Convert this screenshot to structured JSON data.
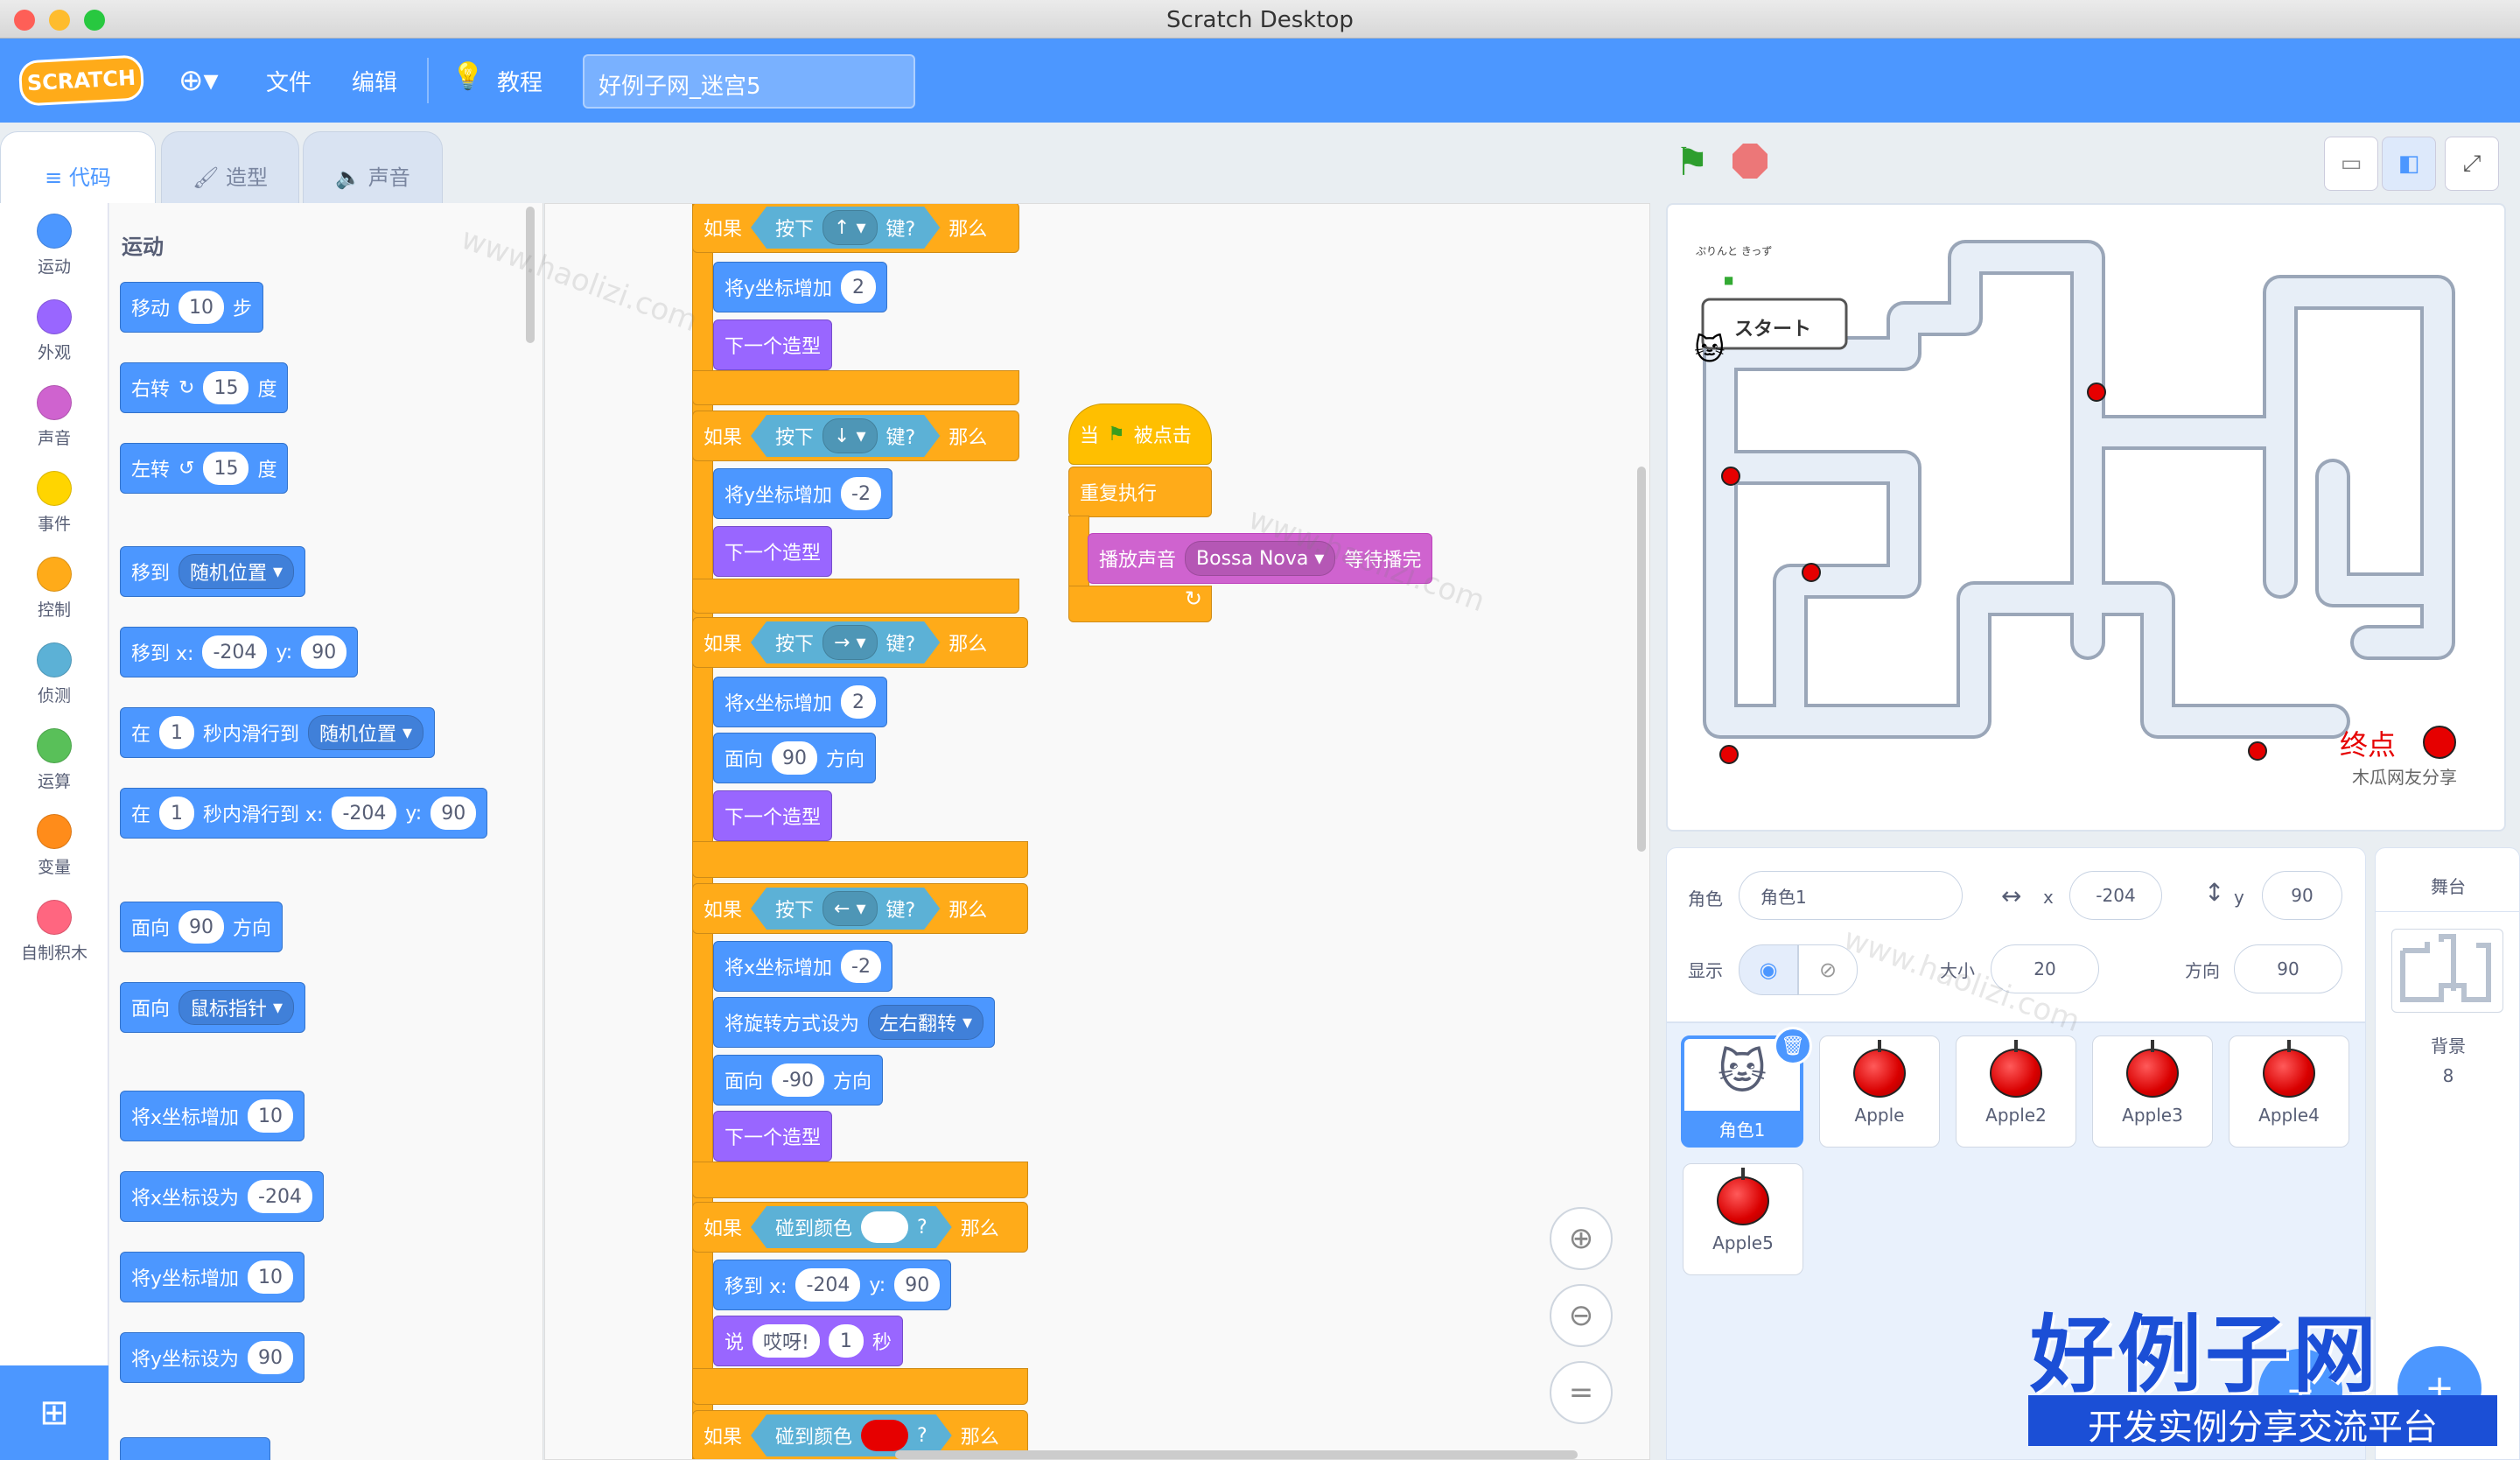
{
  "window": {
    "title": "Scratch Desktop"
  },
  "menu": {
    "logo": "SCRATCH",
    "file": "文件",
    "edit": "编辑",
    "tutorials": "教程",
    "project_title": "好例子网_迷宫5"
  },
  "tabs": {
    "code": "代码",
    "costumes": "造型",
    "sounds": "声音"
  },
  "categories": [
    {
      "label": "运动",
      "color": "#4c97ff"
    },
    {
      "label": "外观",
      "color": "#9966ff"
    },
    {
      "label": "声音",
      "color": "#cf63cf"
    },
    {
      "label": "事件",
      "color": "#ffd500"
    },
    {
      "label": "控制",
      "color": "#ffab19"
    },
    {
      "label": "侦测",
      "color": "#5cb1d6"
    },
    {
      "label": "运算",
      "color": "#59c059"
    },
    {
      "label": "变量",
      "color": "#ff8c1a"
    },
    {
      "label": "自制积木",
      "color": "#ff6680"
    }
  ],
  "palette": {
    "heading": "运动",
    "move": {
      "a": "移动",
      "v": "10",
      "b": "步"
    },
    "turn_right": {
      "a": "右转",
      "v": "15",
      "b": "度"
    },
    "turn_left": {
      "a": "左转",
      "v": "15",
      "b": "度"
    },
    "goto": {
      "a": "移到",
      "dd": "随机位置"
    },
    "goto_xy": {
      "a": "移到 x:",
      "x": "-204",
      "y_label": "y:",
      "y": "90"
    },
    "glide": {
      "a": "在",
      "v": "1",
      "b": "秒内滑行到",
      "dd": "随机位置"
    },
    "glide_xy": {
      "a": "在",
      "v": "1",
      "b": "秒内滑行到 x:",
      "x": "-204",
      "y_label": "y:",
      "y": "90"
    },
    "point": {
      "a": "面向",
      "v": "90",
      "b": "方向"
    },
    "point_towards": {
      "a": "面向",
      "dd": "鼠标指针"
    },
    "change_x": {
      "a": "将x坐标增加",
      "v": "10"
    },
    "set_x": {
      "a": "将x坐标设为",
      "v": "-204"
    },
    "change_y": {
      "a": "将y坐标增加",
      "v": "10"
    },
    "set_y": {
      "a": "将y坐标设为",
      "v": "90"
    }
  },
  "script": {
    "if": "如果",
    "key_pressed": "按下",
    "key_suffix": "键?",
    "then": "那么",
    "up": "↑",
    "down": "↓",
    "right": "→",
    "left": "←",
    "change_y": "将y坐标增加",
    "change_x": "将x坐标增加",
    "next_costume": "下一个造型",
    "v2": "2",
    "vm2": "-2",
    "point": "面向",
    "dir": "方向",
    "v90": "90",
    "vm90": "-90",
    "rotation": "将旋转方式设为",
    "rotation_dd": "左右翻转",
    "touching_color": "碰到颜色",
    "q": "?",
    "goto": "移到 x:",
    "x": "-204",
    "y_label": "y:",
    "y": "90",
    "say": "说",
    "say_text": "哎呀!",
    "say_v": "1",
    "say_sec": "秒",
    "when": "当",
    "clicked": "被点击",
    "forever": "重复执行",
    "play": "播放声音",
    "sound": "Bossa Nova",
    "until": "等待播完"
  },
  "stage": {
    "start_label": "スタート",
    "end_label": "终点",
    "credit": "木瓜网友分享",
    "top_logo": "ぷりんと きっず"
  },
  "sprite_info": {
    "sprite_label": "角色",
    "sprite_name": "角色1",
    "x_label": "x",
    "x": "-204",
    "y_label": "y",
    "y": "90",
    "show_label": "显示",
    "size_label": "大小",
    "size": "20",
    "dir_label": "方向",
    "dir": "90"
  },
  "sprites": [
    {
      "name": "角色1"
    },
    {
      "name": "Apple"
    },
    {
      "name": "Apple2"
    },
    {
      "name": "Apple3"
    },
    {
      "name": "Apple4"
    },
    {
      "name": "Apple5"
    }
  ],
  "stage_panel": {
    "title": "舞台",
    "backdrop_label": "背景",
    "backdrop_count": "8"
  },
  "watermark": {
    "line1": "好例子网",
    "line2": "开发实例分享交流平台",
    "site": "www.haolizi.com"
  }
}
